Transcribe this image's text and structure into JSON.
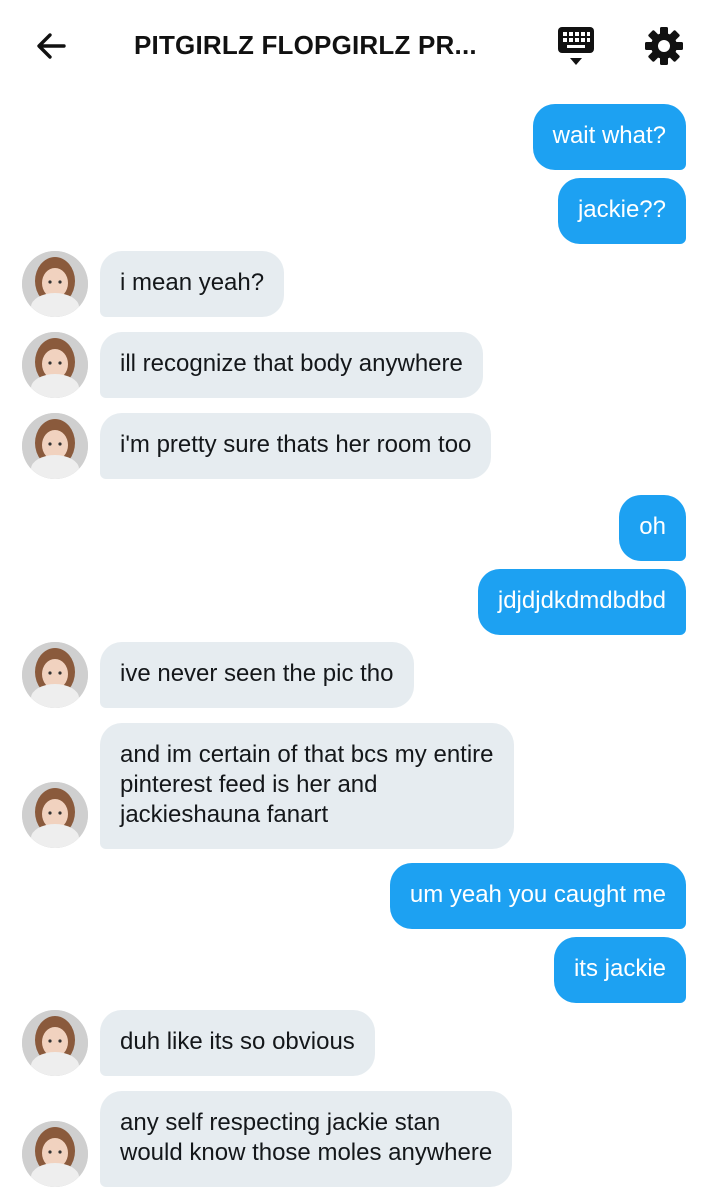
{
  "header": {
    "title": "PITGIRLZ FLOPGIRLZ PR...",
    "back_icon": "arrow-left-icon",
    "keyboard_icon": "keyboard-icon",
    "settings_icon": "gear-icon"
  },
  "colors": {
    "outgoing_bubble": "#1da1f2",
    "incoming_bubble": "#e6ecf0"
  },
  "messages": [
    {
      "dir": "out",
      "text": "wait what?"
    },
    {
      "dir": "out",
      "text": "jackie??"
    },
    {
      "dir": "in",
      "text": "i mean yeah?"
    },
    {
      "dir": "in",
      "text": "ill recognize that body anywhere"
    },
    {
      "dir": "in",
      "text": "i'm pretty sure thats her room too"
    },
    {
      "dir": "out",
      "text": "oh"
    },
    {
      "dir": "out",
      "text": "jdjdjdkdmdbdbd"
    },
    {
      "dir": "in",
      "text": "ive never seen the pic tho"
    },
    {
      "dir": "in",
      "text": "and im certain of that bcs my entire\npinterest feed is her and\njackieshauna fanart"
    },
    {
      "dir": "out",
      "text": "um yeah you caught me"
    },
    {
      "dir": "out",
      "text": "its jackie"
    },
    {
      "dir": "in",
      "text": "duh like its so obvious"
    },
    {
      "dir": "in",
      "text": "any self respecting jackie  stan\nwould know those moles anywhere"
    }
  ]
}
